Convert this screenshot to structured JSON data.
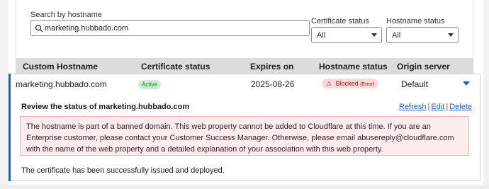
{
  "filters": {
    "search_label": "Search by hostname",
    "search_value": "marketing.hubbado.com",
    "cert_status_label": "Certificate status",
    "cert_status_value": "All",
    "hostname_status_label": "Hostname status",
    "hostname_status_value": "All"
  },
  "table": {
    "headers": [
      "Custom Hostname",
      "Certificate status",
      "Expires on",
      "Hostname status",
      "Origin server"
    ],
    "row": {
      "hostname": "marketing.hubbado.com",
      "cert_status": "Active",
      "expires": "2025-08-26",
      "hostname_status": "Blocked",
      "hostname_status_sub": "(Error)",
      "origin": "Default"
    }
  },
  "detail": {
    "title": "Review the status of marketing.hubbado.com",
    "actions": [
      "Refresh",
      "Edit",
      "Delete"
    ],
    "error_message": "The hostname is part of a banned domain. This web property cannot be added to Cloudflare at this time. If you are an Enterprise customer, please contact your Customer Success Manager. Otherwise, please email abusereply@cloudflare.com with the name of the web property and a detailed explanation of your association with this web property.",
    "success_message": "The certificate has been successfully issued and deployed."
  },
  "colors": {
    "accent": "#1f5fbf",
    "active_badge": "#c8f0d0",
    "blocked_badge": "#fadada",
    "error_bg": "#fdecec",
    "header_bg": "#dcdcdc"
  }
}
